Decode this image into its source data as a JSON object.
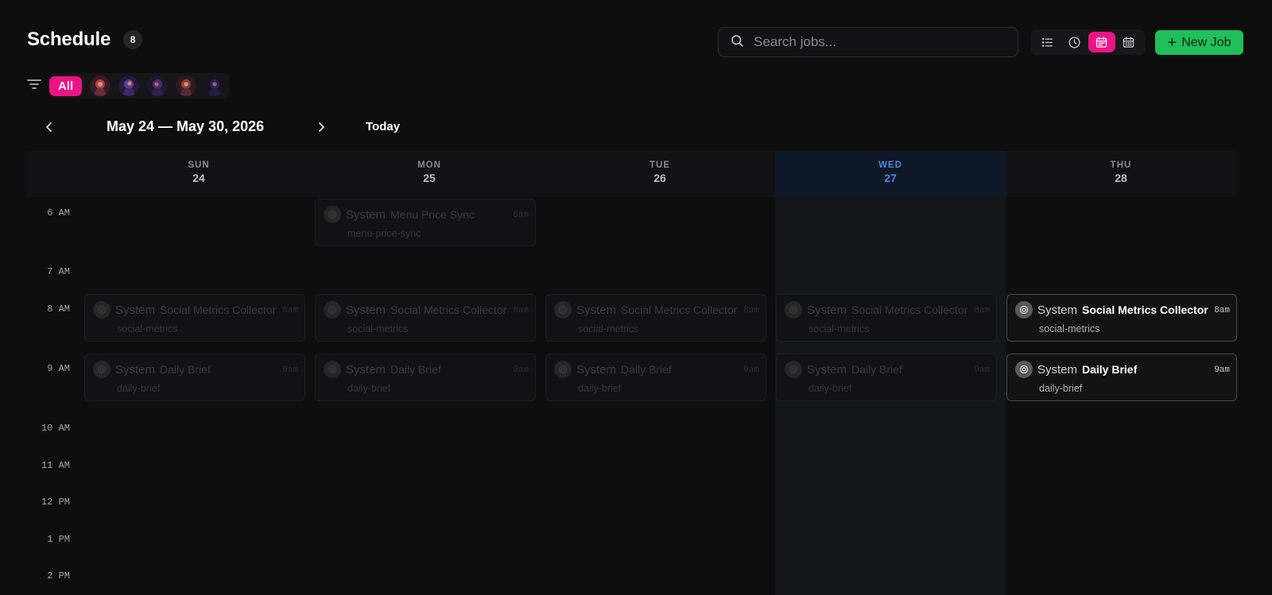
{
  "header": {
    "title": "Schedule",
    "count": "8"
  },
  "search": {
    "placeholder": "Search jobs..."
  },
  "view_toggle": {
    "options": [
      "list-icon",
      "clock-icon",
      "calendar-week-icon",
      "calendar-month-icon"
    ],
    "active": "calendar-week-icon"
  },
  "new_job": {
    "label": "New Job"
  },
  "filters": {
    "all_label": "All",
    "avatars": [
      "agent-avatar-1",
      "agent-avatar-2",
      "agent-avatar-3",
      "agent-avatar-4",
      "agent-avatar-5"
    ]
  },
  "nav": {
    "range": "May 24 — May 30, 2026",
    "today_label": "Today"
  },
  "days": [
    {
      "dow": "SUN",
      "num": "24"
    },
    {
      "dow": "MON",
      "num": "25"
    },
    {
      "dow": "TUE",
      "num": "26"
    },
    {
      "dow": "WED",
      "num": "27"
    },
    {
      "dow": "THU",
      "num": "28"
    }
  ],
  "today_index": 3,
  "time_labels": [
    "6 AM",
    "7 AM",
    "8 AM",
    "9 AM",
    "10 AM",
    "11 AM",
    "12 PM",
    "1 PM",
    "2 PM"
  ],
  "events": [
    {
      "day": 1,
      "who": "System",
      "name": "Menu Price Sync",
      "time": "6am",
      "slug": "menu-price-sync",
      "active": false
    },
    {
      "day": 0,
      "who": "System",
      "name": "Social Metrics Collector",
      "time": "8am",
      "slug": "social-metrics",
      "active": false
    },
    {
      "day": 1,
      "who": "System",
      "name": "Social Metrics Collector",
      "time": "8am",
      "slug": "social-metrics",
      "active": false
    },
    {
      "day": 2,
      "who": "System",
      "name": "Social Metrics Collector",
      "time": "8am",
      "slug": "social-metrics",
      "active": false
    },
    {
      "day": 3,
      "who": "System",
      "name": "Social Metrics Collector",
      "time": "8am",
      "slug": "social-metrics",
      "active": false
    },
    {
      "day": 4,
      "who": "System",
      "name": "Social Metrics Collector",
      "time": "8am",
      "slug": "social-metrics",
      "active": true
    },
    {
      "day": 0,
      "who": "System",
      "name": "Daily Brief",
      "time": "9am",
      "slug": "daily-brief",
      "active": false
    },
    {
      "day": 1,
      "who": "System",
      "name": "Daily Brief",
      "time": "9am",
      "slug": "daily-brief",
      "active": false
    },
    {
      "day": 2,
      "who": "System",
      "name": "Daily Brief",
      "time": "9am",
      "slug": "daily-brief",
      "active": false
    },
    {
      "day": 3,
      "who": "System",
      "name": "Daily Brief",
      "time": "9am",
      "slug": "daily-brief",
      "active": false
    },
    {
      "day": 4,
      "who": "System",
      "name": "Daily Brief",
      "time": "9am",
      "slug": "daily-brief",
      "active": true
    }
  ],
  "colors": {
    "accent": "#ec1386",
    "new_job": "#1fbf5b",
    "today": "#4e86d8"
  }
}
